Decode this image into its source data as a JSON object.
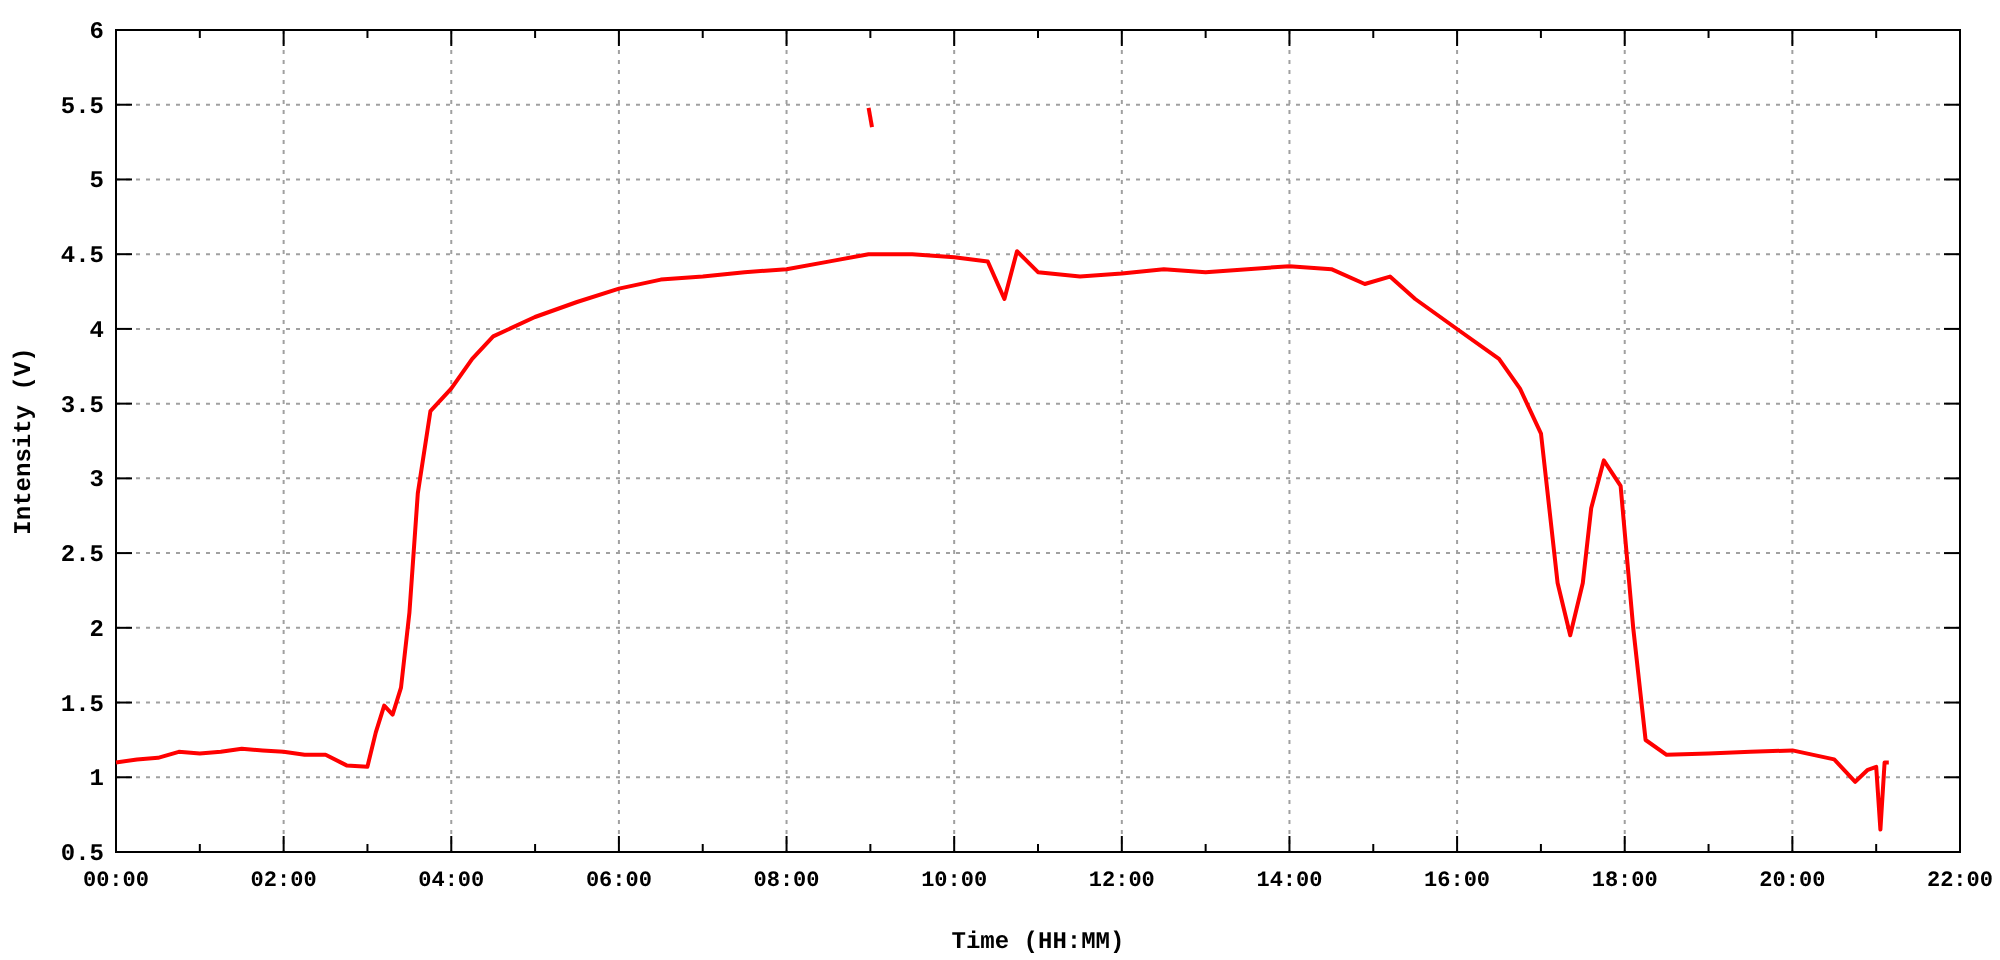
{
  "chart_data": {
    "type": "line",
    "xlabel": "Time (HH:MM)",
    "ylabel": "Intensity (V)",
    "x": [
      0,
      0.25,
      0.5,
      0.75,
      1,
      1.25,
      1.5,
      1.75,
      2,
      2.25,
      2.5,
      2.75,
      3,
      3.1,
      3.2,
      3.3,
      3.4,
      3.5,
      3.6,
      3.75,
      4,
      4.25,
      4.5,
      5,
      5.5,
      6,
      6.5,
      7,
      7.5,
      8,
      8.5,
      8.98,
      9.02,
      9.5,
      10,
      10.4,
      10.6,
      10.75,
      11,
      11.5,
      12,
      12.5,
      13,
      13.5,
      14,
      14.5,
      14.9,
      15.2,
      15.5,
      16,
      16.5,
      16.75,
      17,
      17.2,
      17.35,
      17.5,
      17.6,
      17.75,
      17.95,
      18.1,
      18.25,
      18.5,
      19,
      19.5,
      20,
      20.5,
      20.75,
      20.9,
      21,
      21.05,
      21.1,
      21.15
    ],
    "series": [
      {
        "color": "#ff0000",
        "values": [
          1.1,
          1.12,
          1.13,
          1.17,
          1.16,
          1.17,
          1.19,
          1.18,
          1.17,
          1.15,
          1.15,
          1.08,
          1.07,
          1.3,
          1.48,
          1.42,
          1.6,
          2.1,
          2.9,
          3.45,
          3.6,
          3.8,
          3.95,
          4.08,
          4.18,
          4.27,
          4.33,
          4.35,
          4.38,
          4.4,
          4.45,
          4.5,
          4.5,
          4.5,
          4.48,
          4.45,
          4.2,
          4.52,
          4.38,
          4.35,
          4.37,
          4.4,
          4.38,
          4.4,
          4.42,
          4.4,
          4.3,
          4.35,
          4.2,
          4.0,
          3.8,
          3.6,
          3.3,
          2.3,
          1.95,
          2.3,
          2.8,
          3.12,
          2.95,
          2.0,
          1.25,
          1.15,
          1.16,
          1.17,
          1.18,
          1.12,
          0.97,
          1.05,
          1.07,
          0.65,
          1.1,
          1.1
        ]
      },
      {
        "color": "#ff0000",
        "values": [
          null,
          null,
          null,
          null,
          null,
          null,
          null,
          null,
          null,
          null,
          null,
          null,
          null,
          null,
          null,
          null,
          null,
          null,
          null,
          null,
          null,
          null,
          null,
          null,
          null,
          null,
          null,
          null,
          null,
          null,
          null,
          5.48,
          5.35,
          null,
          null,
          null,
          null,
          null,
          null,
          null,
          null,
          null,
          null,
          null,
          null,
          null,
          null,
          null,
          null,
          null,
          null,
          null,
          null,
          null,
          null,
          null,
          null,
          null,
          null,
          null,
          null,
          null,
          null,
          null,
          null,
          null,
          null,
          null,
          null,
          null,
          null,
          null
        ]
      }
    ],
    "grid": true,
    "xlim": [
      0,
      22
    ],
    "ylim": [
      0.5,
      6
    ],
    "xticks": [
      {
        "value": 0,
        "label": "00:00"
      },
      {
        "value": 2,
        "label": "02:00"
      },
      {
        "value": 4,
        "label": "04:00"
      },
      {
        "value": 6,
        "label": "06:00"
      },
      {
        "value": 8,
        "label": "08:00"
      },
      {
        "value": 10,
        "label": "10:00"
      },
      {
        "value": 12,
        "label": "12:00"
      },
      {
        "value": 14,
        "label": "14:00"
      },
      {
        "value": 16,
        "label": "16:00"
      },
      {
        "value": 18,
        "label": "18:00"
      },
      {
        "value": 20,
        "label": "20:00"
      },
      {
        "value": 22,
        "label": "22:00"
      }
    ],
    "yticks": [
      {
        "value": 0.5,
        "label": "0.5"
      },
      {
        "value": 1,
        "label": "1"
      },
      {
        "value": 1.5,
        "label": "1.5"
      },
      {
        "value": 2,
        "label": "2"
      },
      {
        "value": 2.5,
        "label": "2.5"
      },
      {
        "value": 3,
        "label": "3"
      },
      {
        "value": 3.5,
        "label": "3.5"
      },
      {
        "value": 4,
        "label": "4"
      },
      {
        "value": 4.5,
        "label": "4.5"
      },
      {
        "value": 5,
        "label": "5"
      },
      {
        "value": 5.5,
        "label": "5.5"
      },
      {
        "value": 6,
        "label": "6"
      }
    ]
  }
}
